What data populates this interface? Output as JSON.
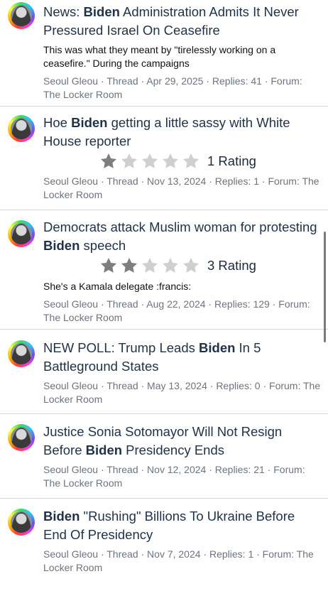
{
  "results": [
    {
      "title_pre": "News: ",
      "title_hl": "Biden",
      "title_post": " Administration Admits It Never Pressured Israel On Ceasefire",
      "snippet": "This was what they meant by \"tirelessly working on a ceasefire.\" During the campaigns",
      "meta": "Seoul Gleou · Thread · Apr 29, 2025 · Replies: 41 · Forum: The Locker Room"
    },
    {
      "title_pre": "Hoe ",
      "title_hl": "Biden",
      "title_post": " getting a little sassy with White House reporter",
      "rating_stars": 1,
      "rating_text": "1 Rating",
      "meta": "Seoul Gleou · Thread · Nov 13, 2024 · Replies: 1 · Forum: The Locker Room"
    },
    {
      "title_pre": "Democrats attack Muslim woman for protesting ",
      "title_hl": "Biden",
      "title_post": " speech",
      "rating_stars": 2,
      "rating_text": "3 Rating",
      "snippet": "She's a Kamala delegate :francis:",
      "meta": "Seoul Gleou · Thread · Aug 22, 2024 · Replies: 129 · Forum: The Locker Room"
    },
    {
      "title_pre": "NEW POLL: Trump Leads ",
      "title_hl": "Biden",
      "title_post": " In 5 Battleground States",
      "meta": "Seoul Gleou · Thread · May 13, 2024 · Replies: 0 · Forum: The Locker Room"
    },
    {
      "title_pre": "Justice Sonia Sotomayor Will Not Resign Before ",
      "title_hl": "Biden",
      "title_post": " Presidency Ends",
      "meta": "Seoul Gleou · Thread · Nov 12, 2024 · Replies: 21 · Forum: The Locker Room"
    },
    {
      "title_pre": "",
      "title_hl": "Biden",
      "title_post": " \"Rushing\" Billions To Ukraine Before End Of Presidency",
      "meta": "Seoul Gleou · Thread · Nov 7, 2024 · Replies: 1 · Forum: The Locker Room"
    }
  ],
  "colors": {
    "star_filled": "#7e7e7e",
    "star_empty": "#cfcfcf"
  }
}
